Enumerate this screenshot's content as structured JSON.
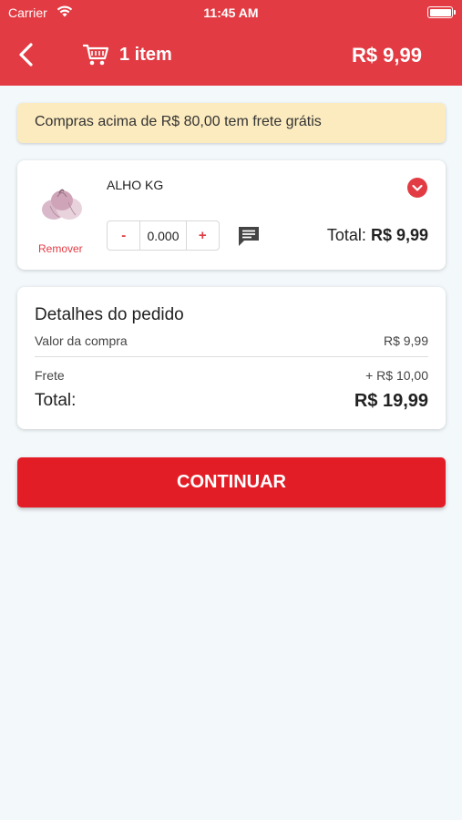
{
  "status_bar": {
    "carrier": "Carrier",
    "time": "11:45 AM"
  },
  "header": {
    "item_count": "1 item",
    "total": "R$ 9,99",
    "accent_color": "#e23b43"
  },
  "banner": {
    "text": "Compras acima de R$ 80,00 tem frete grátis"
  },
  "cart_item": {
    "name": "ALHO KG",
    "remove_label": "Remover",
    "quantity": "0.000",
    "decrement_label": "-",
    "increment_label": "+",
    "total_label": "Total:",
    "total_value": "R$ 9,99"
  },
  "order_details": {
    "title": "Detalhes do pedido",
    "purchase_label": "Valor da compra",
    "purchase_value": "R$ 9,99",
    "shipping_label": "Frete",
    "shipping_value": "+ R$ 10,00",
    "total_label": "Total:",
    "total_value": "R$ 19,99"
  },
  "continue_button": {
    "label": "CONTINUAR",
    "color": "#e21d26"
  }
}
